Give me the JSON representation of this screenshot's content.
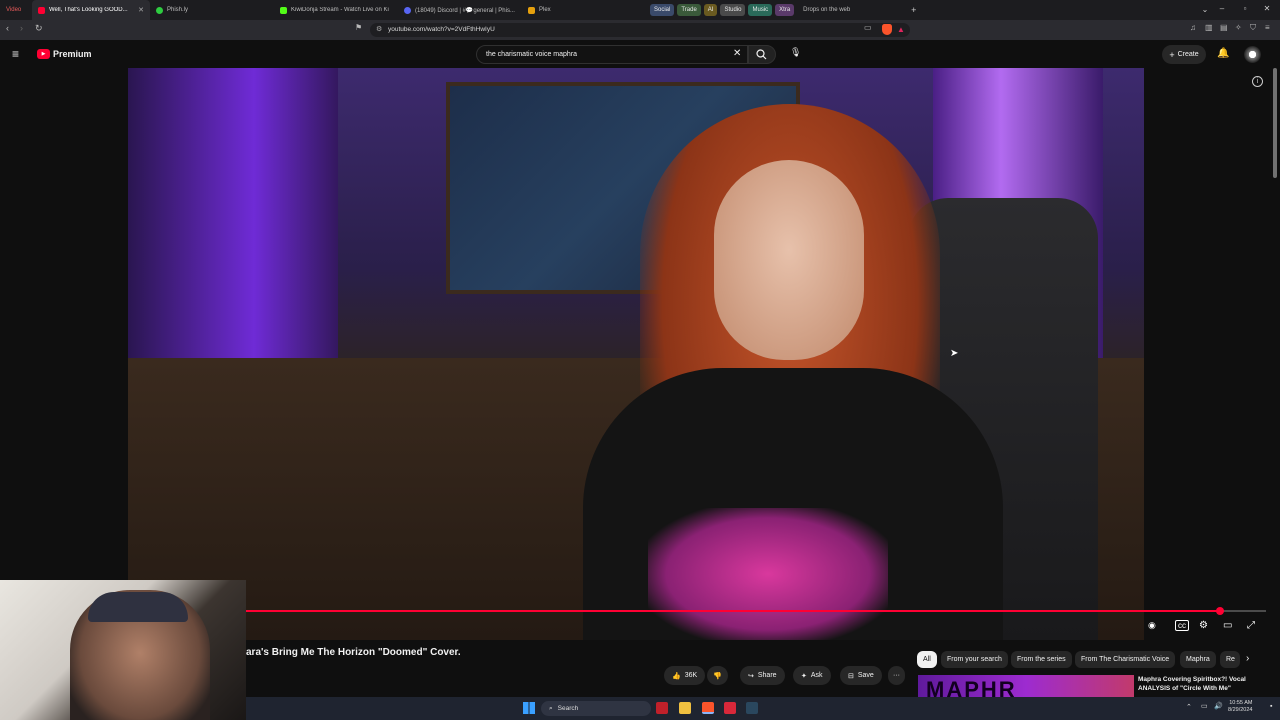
{
  "browser": {
    "tabs": [
      {
        "label": "Video",
        "color": "#c0392b"
      },
      {
        "label": "Well, That's Looking GOOD...",
        "active": true,
        "color": "#ff0033"
      },
      {
        "label": "Phish.ly",
        "color": "#2ecc40"
      },
      {
        "label": "KiwiDonja Stream - Watch Live on Ki...",
        "color": "#53fc18"
      },
      {
        "label": "(18049) Discord | #💬general | Phis...",
        "color": "#5865f2"
      },
      {
        "label": "Plex",
        "color": "#e5a00d"
      }
    ],
    "tab_groups": [
      {
        "label": "Social",
        "color": "#3a4a6a"
      },
      {
        "label": "Trade",
        "color": "#3a5a3a"
      },
      {
        "label": "AI",
        "color": "#6a5a20"
      },
      {
        "label": "Studio",
        "color": "#4a4a4a"
      },
      {
        "label": "Music",
        "color": "#2a6a5a"
      },
      {
        "label": "Xtra",
        "color": "#5a3a6a"
      }
    ],
    "extra_tab": "Drops on the web",
    "new_tab": "+",
    "url": "youtube.com/watch?v=2VdFthHwIyU"
  },
  "youtube": {
    "brand": "Premium",
    "search_query": "the charismatic voice maphra",
    "create_label": "Create"
  },
  "player": {
    "progress": 0.96
  },
  "video": {
    "title": "ara's Bring Me The Horizon \"Doomed\" Cover.",
    "actions": {
      "likes": "36K",
      "share": "Share",
      "ask": "Ask",
      "save": "Save"
    }
  },
  "chips": [
    "All",
    "From your search",
    "From the series",
    "From The Charismatic Voice",
    "Maphra",
    "Re"
  ],
  "recommendation": {
    "thumb_text": "MAPHR",
    "title": "Maphra Covering Spiritbox?! Vocal ANALYSIS of \"Circle With Me\""
  },
  "taskbar": {
    "search": "Search",
    "time": "10:55 AM",
    "date": "8/29/2024"
  }
}
